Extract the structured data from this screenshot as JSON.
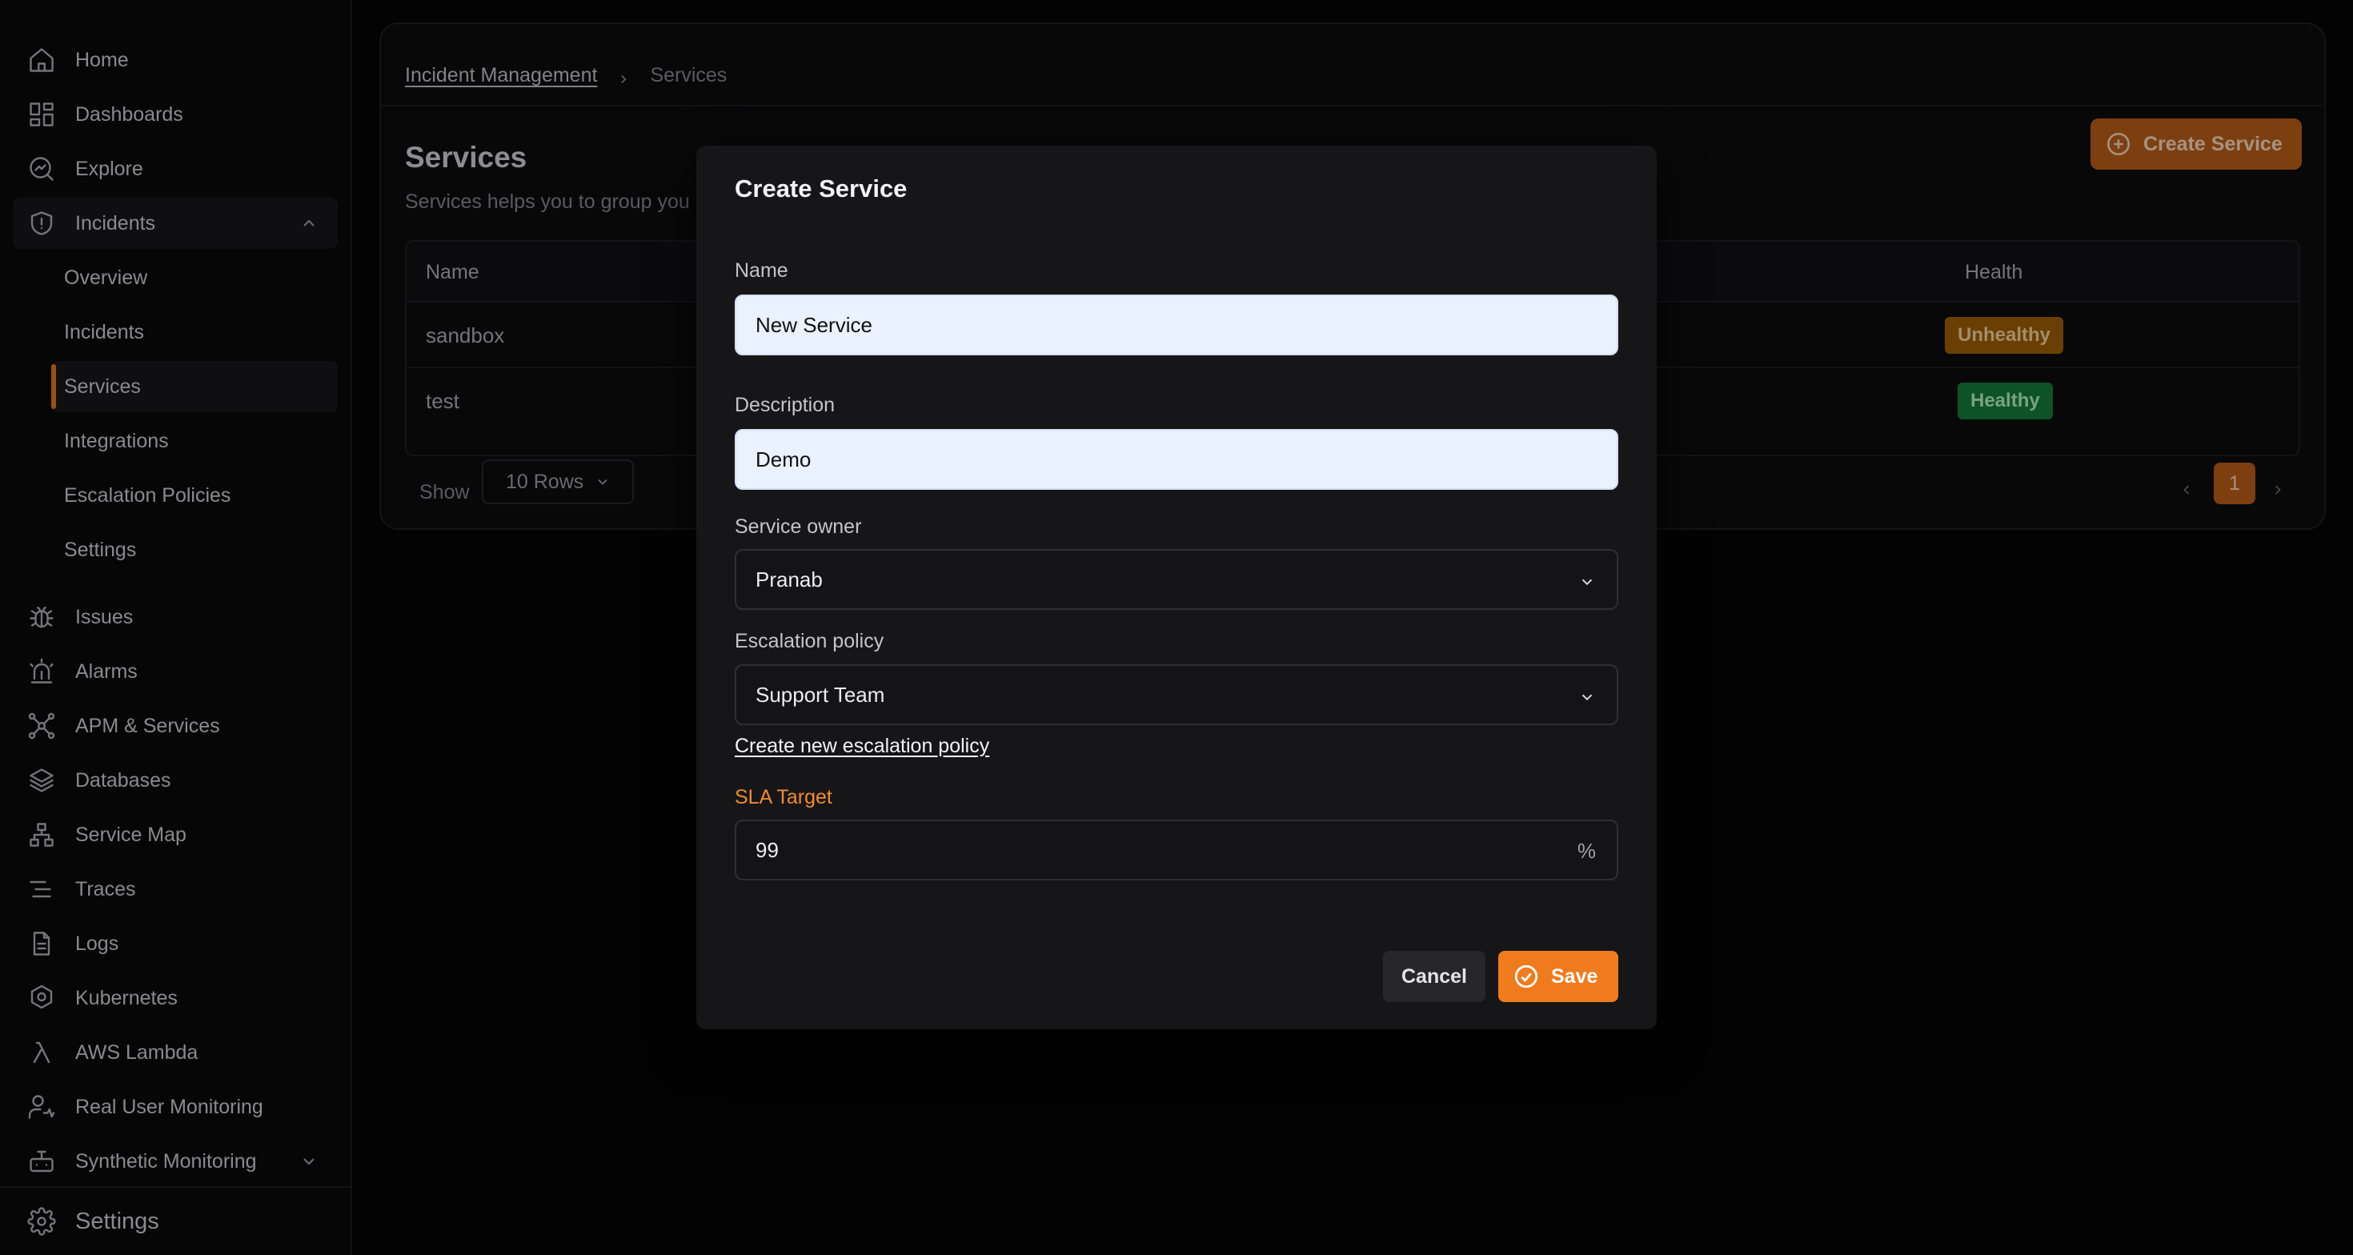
{
  "sidebar": {
    "items": [
      {
        "label": "Home",
        "icon": "home-icon"
      },
      {
        "label": "Dashboards",
        "icon": "dashboard-icon"
      },
      {
        "label": "Explore",
        "icon": "explore-icon"
      },
      {
        "label": "Incidents",
        "icon": "shield-alert-icon",
        "expanded": true
      },
      {
        "label": "Issues",
        "icon": "bug-icon"
      },
      {
        "label": "Alarms",
        "icon": "siren-icon"
      },
      {
        "label": "APM & Services",
        "icon": "network-icon"
      },
      {
        "label": "Databases",
        "icon": "layers-icon"
      },
      {
        "label": "Service Map",
        "icon": "sitemap-icon"
      },
      {
        "label": "Traces",
        "icon": "traces-icon"
      },
      {
        "label": "Logs",
        "icon": "file-text-icon"
      },
      {
        "label": "Kubernetes",
        "icon": "kubernetes-icon"
      },
      {
        "label": "AWS Lambda",
        "icon": "lambda-icon"
      },
      {
        "label": "Real User Monitoring",
        "icon": "user-monitor-icon"
      },
      {
        "label": "Synthetic Monitoring",
        "icon": "robot-icon"
      }
    ],
    "incident_subitems": [
      "Overview",
      "Incidents",
      "Services",
      "Integrations",
      "Escalation Policies",
      "Settings"
    ],
    "active_subitem": "Services",
    "settings_label": "Settings"
  },
  "page": {
    "breadcrumb": {
      "parent": "Incident Management",
      "current": "Services"
    },
    "title": "Services",
    "subtitle": "Services helps you to group you",
    "create_button": "Create Service",
    "table": {
      "columns": [
        "Name",
        "Health"
      ],
      "rows": [
        {
          "name": "sandbox",
          "health": "Unhealthy"
        },
        {
          "name": "test",
          "health": "Healthy"
        }
      ]
    },
    "pagination": {
      "show_label": "Show",
      "rows_option": "10 Rows",
      "current_page": "1"
    }
  },
  "modal": {
    "title": "Create Service",
    "name_label": "Name",
    "name_value": "New Service",
    "description_label": "Description",
    "description_value": "Demo",
    "owner_label": "Service owner",
    "owner_value": "Pranab",
    "escalation_label": "Escalation policy",
    "escalation_value": "Support Team",
    "create_policy_link": "Create new escalation policy",
    "sla_label": "SLA Target",
    "sla_value": "99",
    "sla_suffix": "%",
    "cancel_label": "Cancel",
    "save_label": "Save"
  },
  "colors": {
    "accent": "#f07b1d",
    "unhealthy": "#a16207",
    "healthy": "#15803d"
  }
}
